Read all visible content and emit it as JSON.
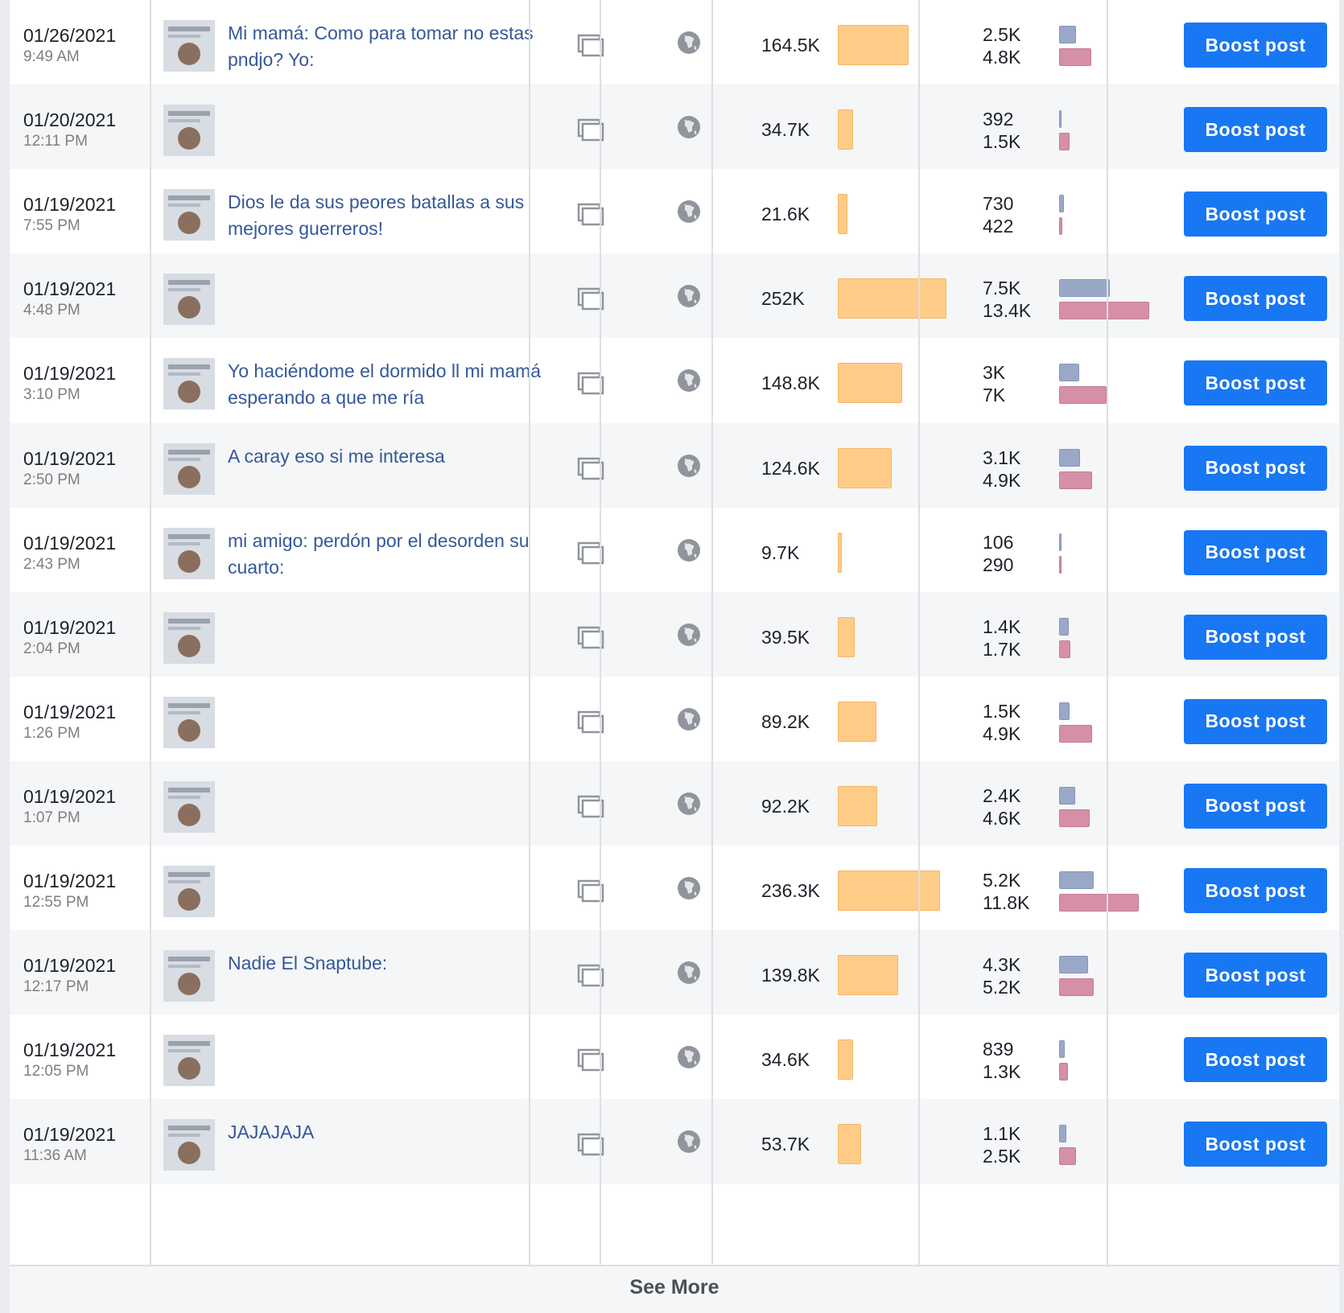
{
  "colors": {
    "accent": "#1877f2",
    "link": "#365899",
    "reach_bar": "#ffcc88",
    "eng_blue": "#9aa8c8",
    "eng_pink": "#d68fa8"
  },
  "icons": {
    "type": "album-icon",
    "privacy": "globe-icon"
  },
  "boost_label": "Boost post",
  "see_more_label": "See More",
  "rows": [
    {
      "date": "01/26/2021",
      "time": "9:49 AM",
      "title": "Mi mamá: Como para tomar no estas pndjo? Yo:",
      "reach": "164.5K",
      "reach_value": 164.5,
      "eng1": "2.5K",
      "eng1_value": 2.5,
      "eng2": "4.8K",
      "eng2_value": 4.8
    },
    {
      "date": "01/20/2021",
      "time": "12:11 PM",
      "title": "",
      "reach": "34.7K",
      "reach_value": 34.7,
      "eng1": "392",
      "eng1_value": 0.392,
      "eng2": "1.5K",
      "eng2_value": 1.5
    },
    {
      "date": "01/19/2021",
      "time": "7:55 PM",
      "title": "Dios le da sus peores batallas a sus mejores guerreros!",
      "reach": "21.6K",
      "reach_value": 21.6,
      "eng1": "730",
      "eng1_value": 0.73,
      "eng2": "422",
      "eng2_value": 0.422
    },
    {
      "date": "01/19/2021",
      "time": "4:48 PM",
      "title": "",
      "reach": "252K",
      "reach_value": 252,
      "eng1": "7.5K",
      "eng1_value": 7.5,
      "eng2": "13.4K",
      "eng2_value": 13.4
    },
    {
      "date": "01/19/2021",
      "time": "3:10 PM",
      "title": "Yo haciéndome el dormido ll mi mamá esperando a que me ría",
      "reach": "148.8K",
      "reach_value": 148.8,
      "eng1": "3K",
      "eng1_value": 3,
      "eng2": "7K",
      "eng2_value": 7
    },
    {
      "date": "01/19/2021",
      "time": "2:50 PM",
      "title": "A caray eso si me interesa",
      "reach": "124.6K",
      "reach_value": 124.6,
      "eng1": "3.1K",
      "eng1_value": 3.1,
      "eng2": "4.9K",
      "eng2_value": 4.9
    },
    {
      "date": "01/19/2021",
      "time": "2:43 PM",
      "title": "mi amigo: perdón por el desorden su cuarto:",
      "reach": "9.7K",
      "reach_value": 9.7,
      "eng1": "106",
      "eng1_value": 0.106,
      "eng2": "290",
      "eng2_value": 0.29
    },
    {
      "date": "01/19/2021",
      "time": "2:04 PM",
      "title": "",
      "reach": "39.5K",
      "reach_value": 39.5,
      "eng1": "1.4K",
      "eng1_value": 1.4,
      "eng2": "1.7K",
      "eng2_value": 1.7
    },
    {
      "date": "01/19/2021",
      "time": "1:26 PM",
      "title": "",
      "reach": "89.2K",
      "reach_value": 89.2,
      "eng1": "1.5K",
      "eng1_value": 1.5,
      "eng2": "4.9K",
      "eng2_value": 4.9
    },
    {
      "date": "01/19/2021",
      "time": "1:07 PM",
      "title": "",
      "reach": "92.2K",
      "reach_value": 92.2,
      "eng1": "2.4K",
      "eng1_value": 2.4,
      "eng2": "4.6K",
      "eng2_value": 4.6
    },
    {
      "date": "01/19/2021",
      "time": "12:55 PM",
      "title": "",
      "reach": "236.3K",
      "reach_value": 236.3,
      "eng1": "5.2K",
      "eng1_value": 5.2,
      "eng2": "11.8K",
      "eng2_value": 11.8
    },
    {
      "date": "01/19/2021",
      "time": "12:17 PM",
      "title": "Nadie El Snaptube:",
      "reach": "139.8K",
      "reach_value": 139.8,
      "eng1": "4.3K",
      "eng1_value": 4.3,
      "eng2": "5.2K",
      "eng2_value": 5.2
    },
    {
      "date": "01/19/2021",
      "time": "12:05 PM",
      "title": "",
      "reach": "34.6K",
      "reach_value": 34.6,
      "eng1": "839",
      "eng1_value": 0.839,
      "eng2": "1.3K",
      "eng2_value": 1.3
    },
    {
      "date": "01/19/2021",
      "time": "11:36 AM",
      "title": "JAJAJAJA",
      "reach": "53.7K",
      "reach_value": 53.7,
      "eng1": "1.1K",
      "eng1_value": 1.1,
      "eng2": "2.5K",
      "eng2_value": 2.5
    }
  ]
}
